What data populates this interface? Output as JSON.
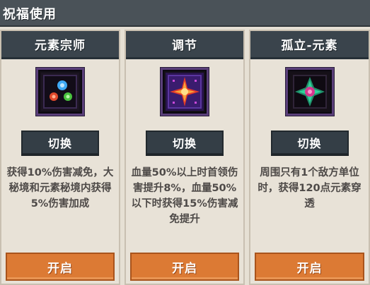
{
  "window": {
    "title": "祝福使用"
  },
  "cards": [
    {
      "title": "元素宗师",
      "icon": "elements-orbs-icon",
      "switch_label": "切换",
      "description": "获得10%伤害减免，大秘境和元素秘境内获得5%伤害加成",
      "enable_label": "开启"
    },
    {
      "title": "调节",
      "icon": "radiant-star-icon",
      "switch_label": "切换",
      "description": "血量50%以上时首领伤害提升8%，血量50%以下时获得15%伤害减免提升",
      "enable_label": "开启"
    },
    {
      "title": "孤立-元素",
      "icon": "isolated-gem-icon",
      "switch_label": "切换",
      "description": "周围只有1个敌方单位时，获得120点元素穿透",
      "enable_label": "开启"
    }
  ],
  "colors": {
    "topbar": "#4a5258",
    "card_header": "#3a444c",
    "switch_button": "#343e46",
    "enable_button": "#dc7a34",
    "card_bg": "#e8e2d7",
    "icon_border": "#5a3f7a"
  }
}
